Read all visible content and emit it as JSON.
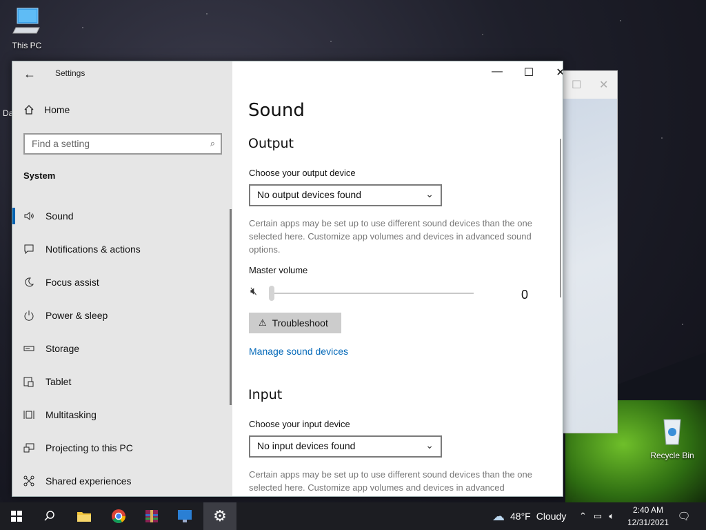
{
  "desktop": {
    "icons": [
      {
        "label": "This PC"
      },
      {
        "label": "Recycle Bin"
      }
    ],
    "partial_text": "Da"
  },
  "settings": {
    "title": "Settings",
    "home": "Home",
    "search_placeholder": "Find a setting",
    "section": "System",
    "nav": [
      {
        "label": "Sound",
        "icon": "speaker-icon",
        "active": true
      },
      {
        "label": "Notifications & actions",
        "icon": "notification-icon"
      },
      {
        "label": "Focus assist",
        "icon": "moon-icon"
      },
      {
        "label": "Power & sleep",
        "icon": "power-icon"
      },
      {
        "label": "Storage",
        "icon": "storage-icon"
      },
      {
        "label": "Tablet",
        "icon": "tablet-icon"
      },
      {
        "label": "Multitasking",
        "icon": "multitasking-icon"
      },
      {
        "label": "Projecting to this PC",
        "icon": "projector-icon"
      },
      {
        "label": "Shared experiences",
        "icon": "shared-icon"
      }
    ],
    "page": {
      "title": "Sound",
      "output": {
        "heading": "Output",
        "device_label": "Choose your output device",
        "device_value": "No output devices found",
        "description": "Certain apps may be set up to use different sound devices than the one selected here. Customize app volumes and devices in advanced sound options.",
        "volume_label": "Master volume",
        "volume_value": "0",
        "troubleshoot": "Troubleshoot",
        "manage_link": "Manage sound devices"
      },
      "input": {
        "heading": "Input",
        "device_label": "Choose your input device",
        "device_value": "No input devices found",
        "description": "Certain apps may be set up to use different sound devices than the one selected here. Customize app volumes and devices in advanced"
      }
    }
  },
  "taskbar": {
    "weather_temp": "48°F",
    "weather_text": "Cloudy",
    "time": "2:40 AM",
    "date": "12/31/2021"
  },
  "colors": {
    "accent": "#0063b1",
    "link": "#0067b8",
    "taskbar": "#1c1d22"
  }
}
